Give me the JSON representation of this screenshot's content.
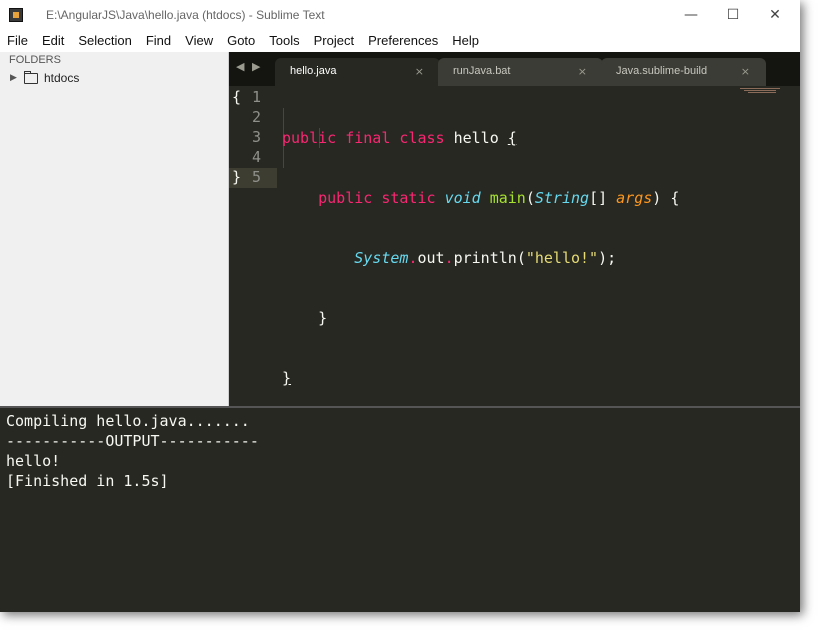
{
  "window": {
    "title": "E:\\AngularJS\\Java\\hello.java (htdocs) - Sublime Text",
    "controls": {
      "minimize": "—",
      "maximize": "☐",
      "close": "✕"
    }
  },
  "menu": [
    "File",
    "Edit",
    "Selection",
    "Find",
    "View",
    "Goto",
    "Tools",
    "Project",
    "Preferences",
    "Help"
  ],
  "sidebar": {
    "header": "FOLDERS",
    "items": [
      {
        "label": "htdocs",
        "icon": "folder-icon",
        "expanded": false
      }
    ]
  },
  "tabs": [
    {
      "label": "hello.java",
      "active": true,
      "close": "×"
    },
    {
      "label": "runJava.bat",
      "active": false,
      "close": "×"
    },
    {
      "label": "Java.sublime-build",
      "active": false,
      "close": "×"
    }
  ],
  "nav_arrows": {
    "back": "◀",
    "forward": "▶"
  },
  "editor": {
    "line_numbers": [
      "1",
      "2",
      "3",
      "4",
      "5"
    ],
    "fold_markers": {
      "open": "{",
      "close": "}"
    },
    "lines": [
      {
        "t1": "public",
        "t2": "final",
        "t3": "class",
        "t4": "hello",
        "t5": "{"
      },
      {
        "t1": "public",
        "t2": "static",
        "t3": "void",
        "t4": "main",
        "t5": "(",
        "t6": "String",
        "t7": "[] ",
        "t8": "args",
        "t9": ") {"
      },
      {
        "t1": "System",
        "t2": ".",
        "t3": "out",
        "t4": ".",
        "t5": "println",
        "t6": "(",
        "t7": "\"hello!\"",
        "t8": ");"
      },
      {
        "t1": "}"
      },
      {
        "t1": "}"
      }
    ]
  },
  "output": {
    "lines": [
      "Compiling hello.java.......",
      "-----------OUTPUT-----------",
      "hello!",
      "[Finished in 1.5s]"
    ]
  },
  "colors": {
    "editor_bg": "#272822",
    "keyword": "#f92672",
    "type": "#66d9ef",
    "function": "#a6e22e",
    "argument": "#fd971f",
    "string": "#e6db74"
  }
}
